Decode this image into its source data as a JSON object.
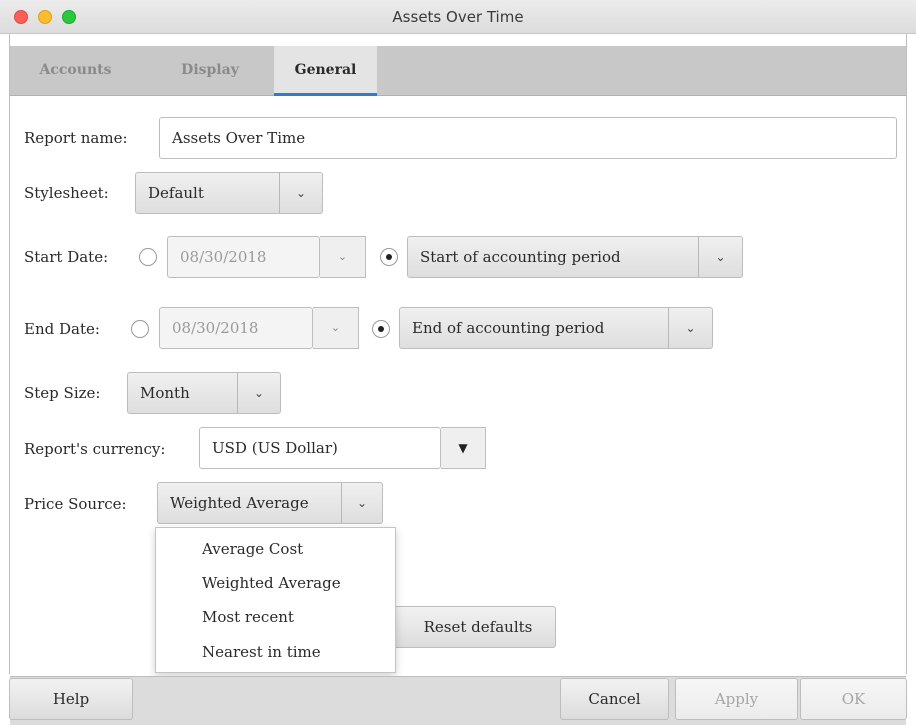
{
  "window": {
    "title": "Assets Over Time"
  },
  "tabs": [
    "Accounts",
    "Display",
    "General"
  ],
  "active_tab": "General",
  "form": {
    "report_name": {
      "label": "Report name:",
      "value": "Assets Over Time"
    },
    "stylesheet": {
      "label": "Stylesheet:",
      "value": "Default"
    },
    "start_date": {
      "label": "Start Date:",
      "date": "08/30/2018",
      "relative": "Start of accounting period"
    },
    "end_date": {
      "label": "End Date:",
      "date": "08/30/2018",
      "relative": "End of accounting period"
    },
    "step_size": {
      "label": "Step Size:",
      "value": "Month"
    },
    "currency": {
      "label": "Report's currency:",
      "value": "USD (US Dollar)"
    },
    "price_source": {
      "label": "Price Source:",
      "value": "Weighted Average"
    }
  },
  "price_source_options": [
    "Average Cost",
    "Weighted Average",
    "Most recent",
    "Nearest in time"
  ],
  "buttons": {
    "reset": "Reset defaults",
    "help": "Help",
    "cancel": "Cancel",
    "apply": "Apply",
    "ok": "OK"
  },
  "icons": {
    "chevron": "chevron-down-icon",
    "triangle": "triangle-down-icon"
  },
  "colors": {
    "accent": "#2e7bd0",
    "close": "#fc5f57",
    "minimize": "#fdbc2e",
    "maximize": "#29c840"
  }
}
